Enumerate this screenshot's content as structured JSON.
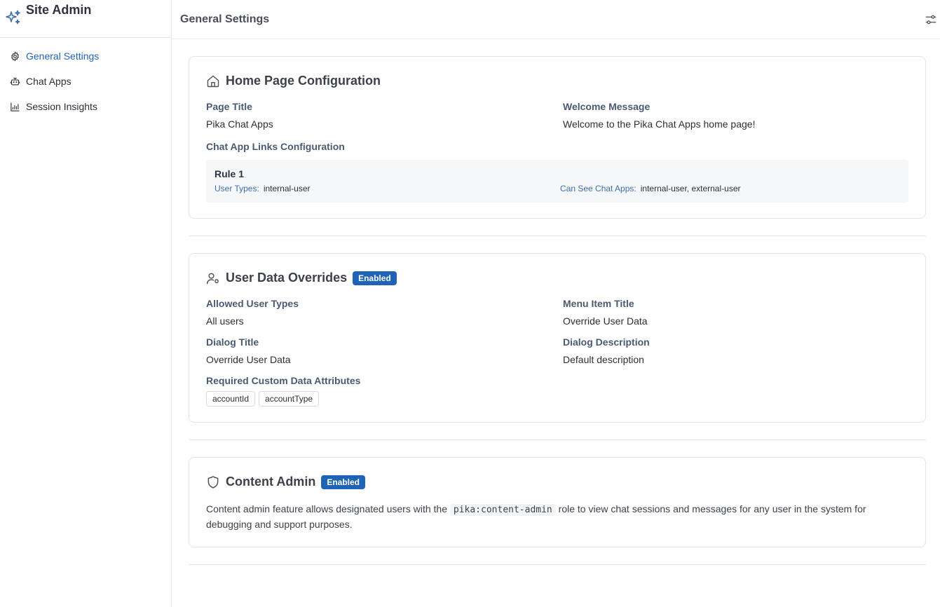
{
  "sidebar": {
    "brand_title": "Site Admin",
    "items": [
      {
        "label": "General Settings",
        "icon": "gear-icon",
        "active": true
      },
      {
        "label": "Chat Apps",
        "icon": "bot-icon",
        "active": false
      },
      {
        "label": "Session Insights",
        "icon": "bar-chart-icon",
        "active": false
      }
    ]
  },
  "header": {
    "title": "General Settings",
    "settings_icon": "sliders-icon"
  },
  "home_page": {
    "title": "Home Page Configuration",
    "icon": "home-icon",
    "page_title_label": "Page Title",
    "page_title_value": "Pika Chat Apps",
    "welcome_label": "Welcome Message",
    "welcome_value": "Welcome to the Pika Chat Apps home page!",
    "links_label": "Chat App Links Configuration",
    "rule": {
      "title": "Rule 1",
      "user_types_key": "User Types:",
      "user_types_value": "internal-user",
      "can_see_key": "Can See Chat Apps:",
      "can_see_value": "internal-user, external-user"
    }
  },
  "user_overrides": {
    "title": "User Data Overrides",
    "icon": "user-cog-icon",
    "badge": "Enabled",
    "allowed_label": "Allowed User Types",
    "allowed_value": "All users",
    "menu_label": "Menu Item Title",
    "menu_value": "Override User Data",
    "dialog_title_label": "Dialog Title",
    "dialog_title_value": "Override User Data",
    "dialog_desc_label": "Dialog Description",
    "dialog_desc_value": "Default description",
    "required_label": "Required Custom Data Attributes",
    "attributes": [
      "accountId",
      "accountType"
    ]
  },
  "content_admin": {
    "title": "Content Admin",
    "icon": "shield-icon",
    "badge": "Enabled",
    "desc_before": "Content admin feature allows designated users with the",
    "desc_code": "pika:content-admin",
    "desc_after": "role to view chat sessions and messages for any user in the system for debugging and support purposes."
  },
  "colors": {
    "accent": "#1f63b5",
    "badge_bg": "#1f63b5"
  }
}
